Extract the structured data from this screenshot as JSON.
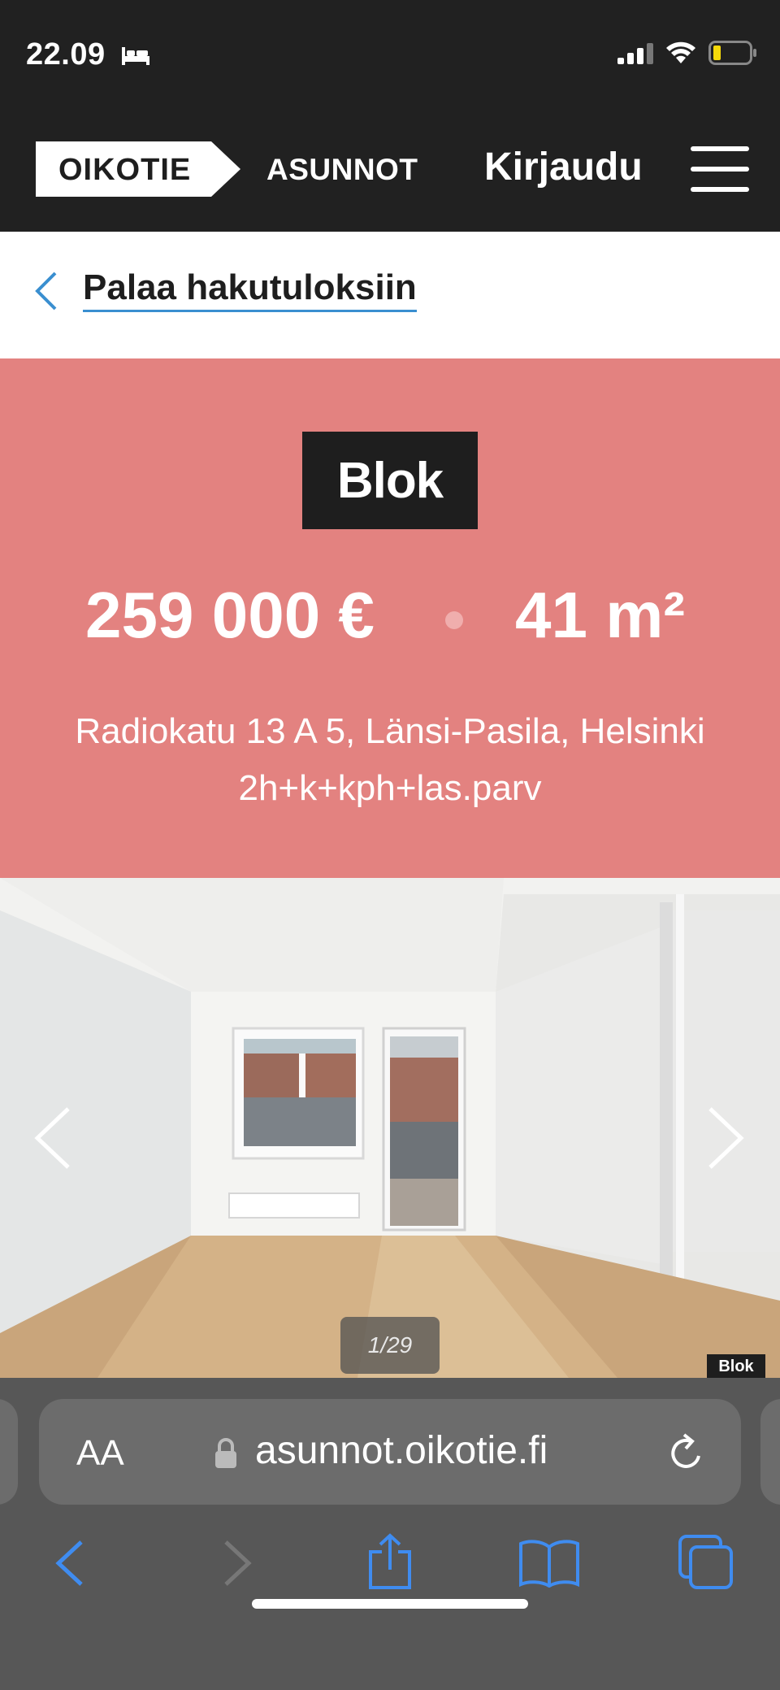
{
  "status_bar": {
    "time": "22.09",
    "icons": [
      "bed-icon",
      "signal-icon",
      "wifi-icon",
      "battery-icon"
    ]
  },
  "header": {
    "logo": "OIKOTIE",
    "section": "ASUNNOT",
    "login_label": "Kirjaudu",
    "menu_icon": "hamburger-menu-icon"
  },
  "back_link": {
    "label": "Palaa hakutuloksiin",
    "icon": "chevron-left-icon"
  },
  "listing": {
    "agency_logo": "Blok",
    "price": "259 000 €",
    "size": "41 m²",
    "address": "Radiokatu 13 A 5, Länsi-Pasila, Helsinki",
    "room_layout": "2h+k+kph+las.parv"
  },
  "gallery": {
    "counter": "1/29",
    "watermark": "Blok",
    "prev_icon": "chevron-left-icon",
    "next_icon": "chevron-right-icon"
  },
  "browser": {
    "text_size_label": "AA",
    "url": "asunnot.oikotie.fi",
    "toolbar": [
      "back-icon",
      "forward-icon",
      "share-icon",
      "bookmarks-icon",
      "tabs-icon"
    ]
  },
  "colors": {
    "header_bg": "#212121",
    "hero_bg": "#e38280",
    "link_underline": "#3a8fd0",
    "safari_bg": "#575757",
    "safari_accent": "#3f8cf0"
  }
}
